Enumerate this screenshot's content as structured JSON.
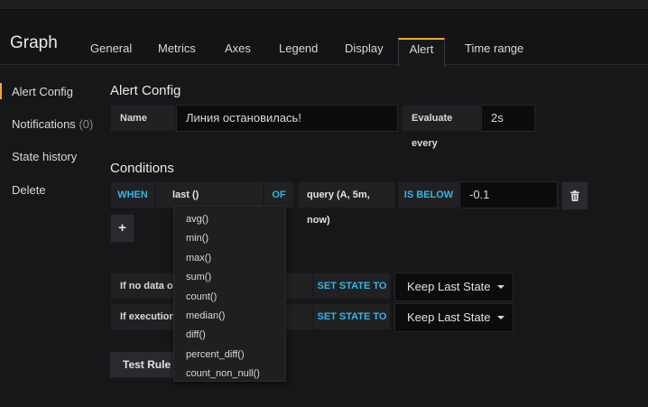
{
  "header": {
    "title": "Graph",
    "tabs": [
      "General",
      "Metrics",
      "Axes",
      "Legend",
      "Display",
      "Alert",
      "Time range"
    ],
    "active_tab": "Alert"
  },
  "sidenav": {
    "items": [
      {
        "label": "Alert Config"
      },
      {
        "label": "Notifications",
        "count": "(0)"
      },
      {
        "label": "State history"
      },
      {
        "label": "Delete"
      }
    ]
  },
  "alert_config": {
    "title": "Alert Config",
    "name_label": "Name",
    "name_value": "Линия остановилась!",
    "evaluate_label": "Evaluate every",
    "evaluate_value": "2s"
  },
  "conditions": {
    "title": "Conditions",
    "when": "WHEN",
    "func": "last ()",
    "of": "OF",
    "query": "query (A, 5m, now)",
    "op": "IS BELOW",
    "threshold": "-0.1",
    "add_label": "+"
  },
  "func_dropdown": {
    "options": [
      "avg()",
      "min()",
      "max()",
      "sum()",
      "count()",
      "median()",
      "diff()",
      "percent_diff()",
      "count_non_null()"
    ]
  },
  "state_rules": [
    {
      "label": "If no data or",
      "set_state": "SET STATE TO",
      "value": "Keep Last State"
    },
    {
      "label": "If execution e",
      "set_state": "SET STATE TO",
      "value": "Keep Last State"
    }
  ],
  "test_rule_label": "Test Rule",
  "colors": {
    "accent": "#ffa81f",
    "keyword": "#33b5e5"
  },
  "icons": {
    "delete": "trash-icon",
    "add": "plus-icon",
    "caret": "chevron-down-icon"
  }
}
